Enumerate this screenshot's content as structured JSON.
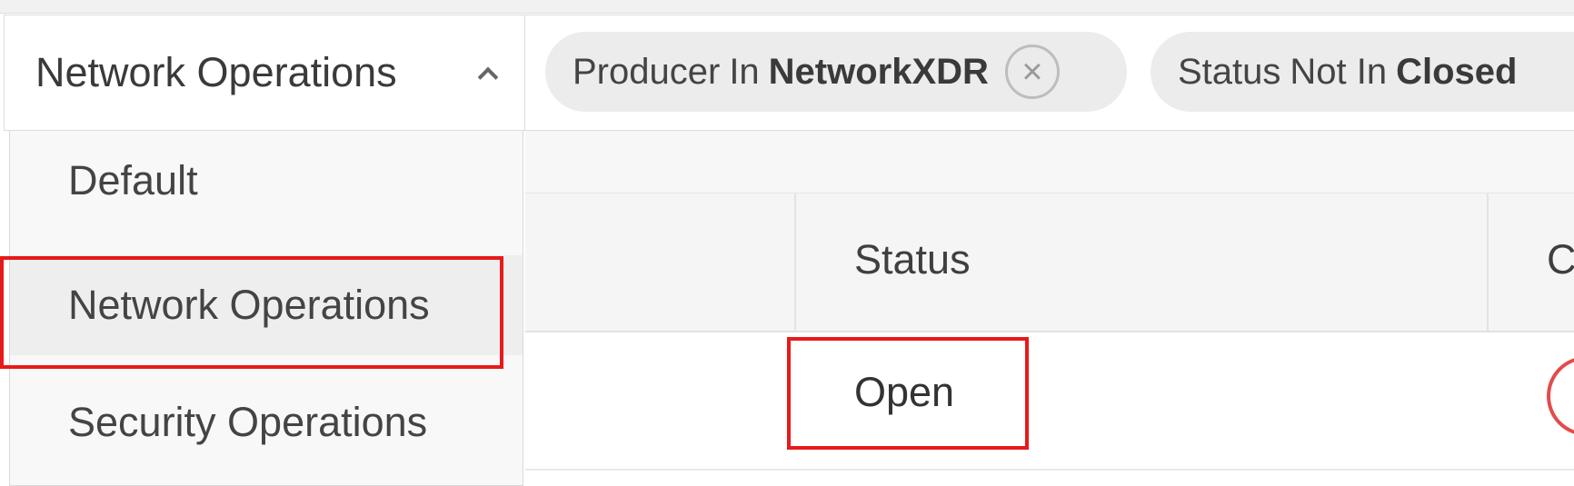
{
  "view_selector": {
    "current_view": "Network Operations",
    "options": [
      "Default",
      "Network Operations",
      "Security Operations"
    ],
    "highlighted_option": "Network Operations"
  },
  "filters": [
    {
      "field": "Producer",
      "operator": "In",
      "value": "NetworkXDR"
    },
    {
      "field": "Status",
      "operator": "Not In",
      "value": "Closed"
    }
  ],
  "table": {
    "columns": [
      "Status",
      "C"
    ],
    "rows": [
      {
        "status": "Open"
      }
    ]
  },
  "icons": {
    "chevron": "chevron-up-icon",
    "chip_close": "close-circle-icon",
    "severity": "severity-ring-icon"
  },
  "colors": {
    "highlight": "#e81919",
    "severity_ring": "#e34b4b",
    "chip_bg": "#ececec"
  }
}
